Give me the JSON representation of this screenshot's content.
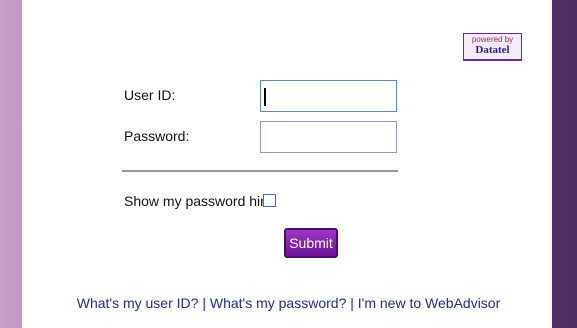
{
  "logo": {
    "small_text": "powered by",
    "brand": "Datatel"
  },
  "login": {
    "user_id_label": "User ID:",
    "password_label": "Password:",
    "password_hint_label": "Show my password hint:",
    "submit_label": "Submit"
  },
  "links": [
    "What's my user ID?",
    "What's my password?",
    "I'm new to WebAdvisor"
  ],
  "link_separator": "|"
}
